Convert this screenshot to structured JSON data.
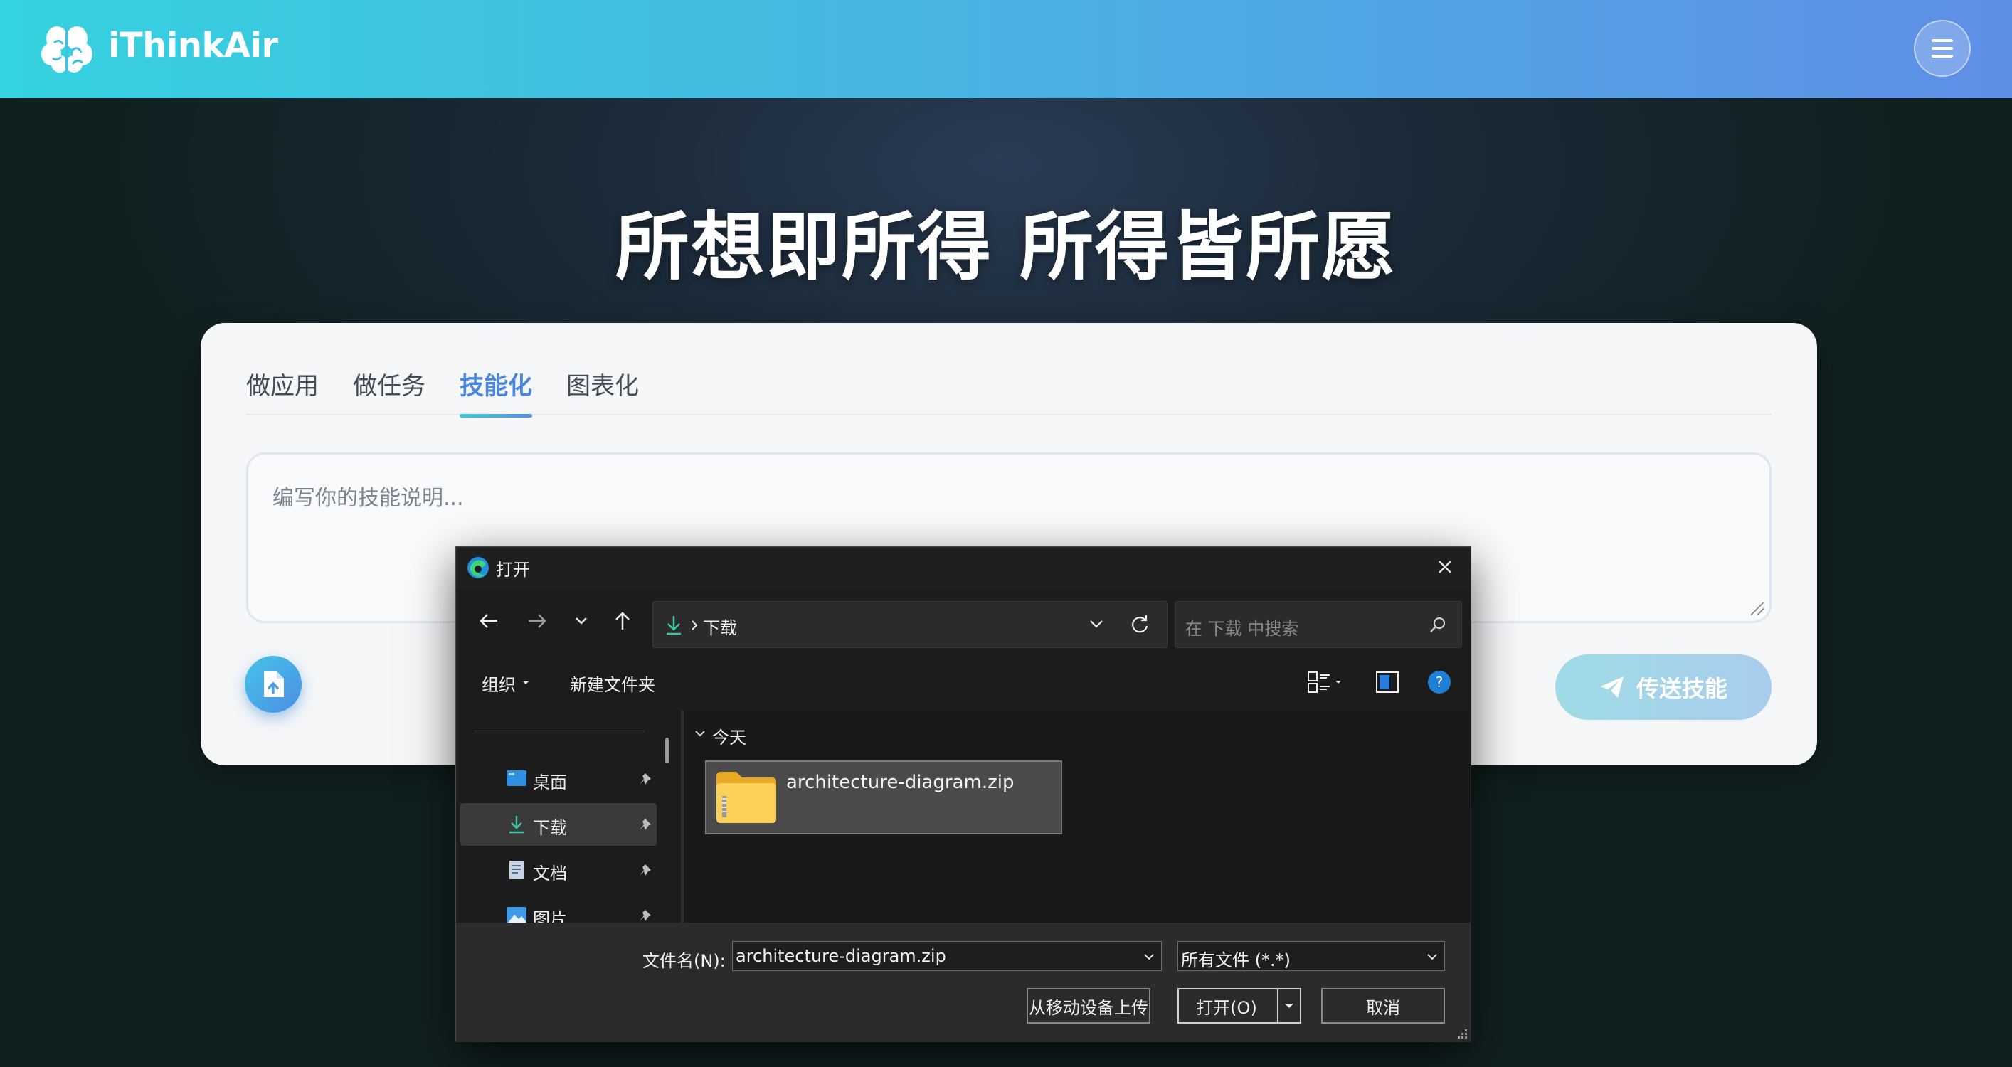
{
  "header": {
    "brand": "iThinkAir",
    "icons": {
      "logo": "brain-icon",
      "menu": "hamburger-menu-icon"
    }
  },
  "hero": {
    "title": "所想即所得 所得皆所愿"
  },
  "card": {
    "tabs": [
      {
        "label": "做应用",
        "active": false
      },
      {
        "label": "做任务",
        "active": false
      },
      {
        "label": "技能化",
        "active": true
      },
      {
        "label": "图表化",
        "active": false
      }
    ],
    "textarea": {
      "placeholder": "编写你的技能说明..."
    },
    "send_label": "传送技能",
    "colors": {
      "accent": "#4a86e0",
      "gradient_start": "#39cadc",
      "gradient_end": "#5a8fe6"
    }
  },
  "dialog": {
    "title": "打开",
    "address": {
      "current": "下载"
    },
    "search": {
      "placeholder": "在 下载 中搜索"
    },
    "commands": {
      "organize": "组织",
      "new_folder": "新建文件夹"
    },
    "sidebar": [
      {
        "label": "桌面",
        "icon": "desktop-icon",
        "selected": false
      },
      {
        "label": "下载",
        "icon": "download-icon",
        "selected": true
      },
      {
        "label": "文档",
        "icon": "document-icon",
        "selected": false
      },
      {
        "label": "图片",
        "icon": "picture-icon",
        "selected": false
      }
    ],
    "group": {
      "label": "今天"
    },
    "files": [
      {
        "name": "architecture-diagram.zip",
        "icon": "zip-folder-icon"
      }
    ],
    "footer": {
      "filename_label": "文件名(N):",
      "filename_value": "architecture-diagram.zip",
      "filetype_value": "所有文件 (*.*)",
      "upload_mobile": "从移动设备上传",
      "open": "打开(O)",
      "cancel": "取消"
    }
  }
}
